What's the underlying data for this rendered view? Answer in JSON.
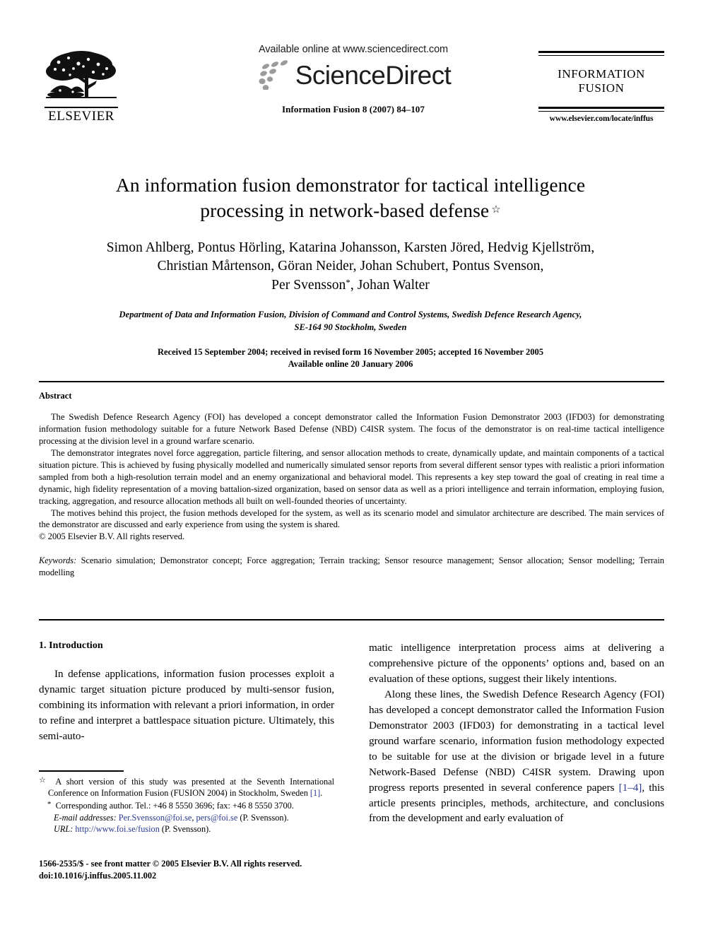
{
  "masthead": {
    "elsevier_wordmark": "ELSEVIER",
    "elsevier_logo_icon": "elsevier-tree-logo",
    "available_online": "Available online at www.sciencedirect.com",
    "sciencedirect_wordmark": "ScienceDirect",
    "sciencedirect_mark_icon": "sciencedirect-dots-logo",
    "journal_reference": "Information Fusion 8 (2007) 84–107",
    "journal_name_line1": "INFORMATION",
    "journal_name_line2": "FUSION",
    "journal_url": "www.elsevier.com/locate/inffus"
  },
  "title": {
    "line1": "An information fusion demonstrator for tactical intelligence",
    "line2": "processing in network-based defense",
    "footnote_marker": "☆"
  },
  "authors": {
    "line1": "Simon Ahlberg, Pontus Hörling, Katarina Johansson, Karsten Jöred, Hedvig Kjellström,",
    "line2": "Christian Mårtenson, Göran Neider, Johan Schubert, Pontus Svenson,",
    "line3_pre": "Per Svensson",
    "line3_marker": "*",
    "line3_post": ", Johan Walter"
  },
  "affiliation": {
    "line1": "Department of Data and Information Fusion, Division of Command and Control Systems, Swedish Defence Research Agency,",
    "line2": "SE-164 90 Stockholm, Sweden"
  },
  "history": {
    "line1": "Received 15 September 2004; received in revised form 16 November 2005; accepted 16 November 2005",
    "line2": "Available online 20 January 2006"
  },
  "abstract": {
    "heading": "Abstract",
    "paragraphs": [
      "The Swedish Defence Research Agency (FOI) has developed a concept demonstrator called the Information Fusion Demonstrator 2003 (IFD03) for demonstrating information fusion methodology suitable for a future Network Based Defense (NBD) C4ISR system. The focus of the demonstrator is on real-time tactical intelligence processing at the division level in a ground warfare scenario.",
      "The demonstrator integrates novel force aggregation, particle filtering, and sensor allocation methods to create, dynamically update, and maintain components of a tactical situation picture. This is achieved by fusing physically modelled and numerically simulated sensor reports from several different sensor types with realistic a priori information sampled from both a high-resolution terrain model and an enemy organizational and behavioral model. This represents a key step toward the goal of creating in real time a dynamic, high fidelity representation of a moving battalion-sized organization, based on sensor data as well as a priori intelligence and terrain information, employing fusion, tracking, aggregation, and resource allocation methods all built on well-founded theories of uncertainty.",
      "The motives behind this project, the fusion methods developed for the system, as well as its scenario model and simulator architecture are described. The main services of the demonstrator are discussed and early experience from using the system is shared."
    ],
    "copyright": "© 2005 Elsevier B.V. All rights reserved."
  },
  "keywords": {
    "label": "Keywords:",
    "text": " Scenario simulation; Demonstrator concept; Force aggregation; Terrain tracking; Sensor resource management; Sensor allocation; Sensor modelling; Terrain modelling"
  },
  "body": {
    "section_heading": "1. Introduction",
    "left_paragraph": "In defense applications, information fusion processes exploit a dynamic target situation picture produced by multi-sensor fusion, combining its information with relevant a priori information, in order to refine and interpret a battlespace situation picture. Ultimately, this semi-auto-",
    "right_paragraph_1": "matic intelligence interpretation process aims at delivering a comprehensive picture of the opponents’ options and, based on an evaluation of these options, suggest their likely intentions.",
    "right_paragraph_2_part1": "Along these lines, the Swedish Defence Research Agency (FOI) has developed a concept demonstrator called the Information Fusion Demonstrator 2003 (IFD03) for demonstrating in a tactical level ground warfare scenario, information fusion methodology expected to be suitable for use at the division or brigade level in a future Network-Based Defense (NBD) C4ISR system. Drawing upon progress reports presented in several conference papers ",
    "right_paragraph_2_ref": "[1–4]",
    "right_paragraph_2_part2": ", this article presents principles, methods, architecture, and conclusions from the development and early evaluation of"
  },
  "footnotes": {
    "star_marker": "☆",
    "star_text_pre": " A short version of this study was presented at the Seventh International Conference on Information Fusion (FUSION 2004) in Stockholm, Sweden ",
    "star_text_ref": "[1]",
    "star_text_post": ".",
    "corr_marker": "*",
    "corr_text": " Corresponding author. Tel.: +46 8 5550 3696; fax: +46 8 5550 3700.",
    "email_label": "E-mail addresses:",
    "email_1": "Per.Svensson@foi.se",
    "email_sep": ", ",
    "email_2": "pers@foi.se",
    "email_suffix": " (P. Svensson).",
    "url_label": "URL:",
    "url_value": "http://www.foi.se/fusion",
    "url_suffix": " (P. Svensson)."
  },
  "imprint": {
    "line1": "1566-2535/$ - see front matter © 2005 Elsevier B.V. All rights reserved.",
    "line2": "doi:10.1016/j.inffus.2005.11.002"
  },
  "colors": {
    "text": "#000000",
    "link": "#2b3a8f",
    "background": "#ffffff"
  }
}
